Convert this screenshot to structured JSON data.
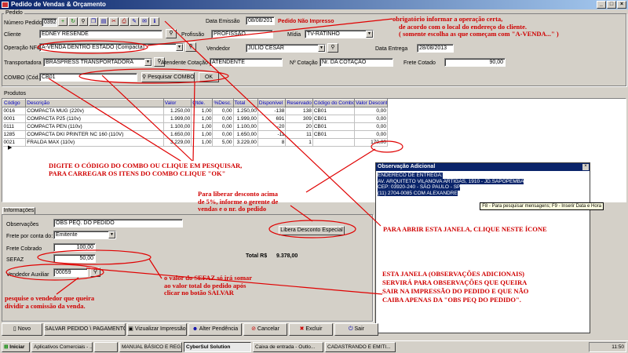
{
  "window": {
    "title": "Pedido de Vendas & Orçamento"
  },
  "header": {
    "pedido_group": "Pedido",
    "numero_label": "Número Pedido",
    "numero_value": "03924",
    "emissao_label": "Data Emissão",
    "emissao_value": "08/08/201",
    "status": "Pedido Não Impresso",
    "cliente_label": "Cliente",
    "cliente_value": "EDNEY RESENDE",
    "profissao_label": "Profissão",
    "profissao_value": "PROFISSÃO",
    "midia_label": "Mídia",
    "midia_value": "TV-RATINHO",
    "operacao_label": "Operação NFe",
    "operacao_value": "A-VENDA DENTRO ESTADO (Compacta)",
    "vendedor_label": "Vendedor",
    "vendedor_value": "JULIO CESAR",
    "entrega_label": "Data Entrega",
    "entrega_value": "28/08/2013",
    "transportadora_label": "Transportadora",
    "transportadora_value": "BRASPRESS TRANSPORTADORA",
    "atendente_label": "Atendente Cotação",
    "atendente_value": "ATENDENTE",
    "ncotacao_label": "Nº Cotação",
    "ncotacao_value": "Nr. DA COTAÇÃO",
    "frete_cotado_label": "Frete Cotado",
    "frete_cotado_value": "90,00",
    "combo_label": "COMBO (Cód.)",
    "combo_value": "CB01",
    "pesquisar_combo": "Pesquisar COMBO",
    "ok": "OK"
  },
  "produtos": {
    "group": "Produtos",
    "columns": [
      "Código",
      "Descrição",
      "Valor",
      "Qtde.",
      "%Desc.",
      "Total",
      "Disponível",
      "Reservado",
      "Código do Combo",
      "Valor Desconto"
    ],
    "rows": [
      [
        "0016",
        "COMPACTA MUG (220v)",
        "1.250,00",
        "1,00",
        "0,00",
        "1.250,00",
        "-138",
        "138",
        "CB01",
        "0,00"
      ],
      [
        "0001",
        "COMPACTA P25 (110v)",
        "1.999,00",
        "1,00",
        "0,00",
        "1.999,00",
        "691",
        "309",
        "CB01",
        "0,00"
      ],
      [
        "0111",
        "COMPACTA PEN (110v)",
        "1.100,00",
        "1,00",
        "0,00",
        "1.100,00",
        "-20",
        "20",
        "CB01",
        "0,00"
      ],
      [
        "1285",
        "COMPACTA DKI PRINTER NC 160 (110V)",
        "1.650,00",
        "1,00",
        "0,00",
        "1.650,00",
        "-11",
        "11",
        "CB01",
        "0,00"
      ],
      [
        "0021",
        "FRALDA MAX (110v)",
        "3.229,00",
        "1,00",
        "5,00",
        "3.229,00",
        "8",
        "1",
        "",
        "170,00"
      ]
    ]
  },
  "info": {
    "tab": "Informações",
    "obs_label": "Observações",
    "obs_value": "OBS PEQ. DO PEDIDO",
    "frete_conta_label": "Frete por conta do:",
    "frete_conta_value": "Emitente",
    "frete_cobrado_label": "Frete Cobrado",
    "frete_cobrado_value": "100,00",
    "sefaz_label": "SEFAZ",
    "sefaz_value": "50,00",
    "vend_aux_label": "Vendedor Auxiliar",
    "vend_aux_value": "00059",
    "libera": "Libera Desconto Especial",
    "total_label": "Total R$",
    "total_value": "9.378,00"
  },
  "popup": {
    "title": "Observação Adicional",
    "lines": [
      "ENDERECO DE ENTREGA:",
      "AV. ARQUITETO VILANOVA ARTIGAS, 1910 - JD.SAPOPEMBA",
      "CEP: 03920-240 - SÃO PAULO - SP",
      "(11) 2704-0085 COM ALEXANDRE"
    ],
    "hint": "F8 - Para pesquisar mensagens; F9 - Inserir Data e Hora"
  },
  "bottom": {
    "novo": "Novo",
    "salvar": "SALVAR PEDIDO \\ PAGAMENTOS",
    "visualizar": "Vizualizar Impressão",
    "alter": "Alter Pendência",
    "cancelar": "Cancelar",
    "excluir": "Excluir",
    "sair": "Sair"
  },
  "annotations": {
    "a1": "obrigatório informar a operação certa,",
    "a2": "de acordo com o local do endereço do cliente.",
    "a3": "( somente escolha as que começam com \"A-VENDA...\" )",
    "combo1": "DIGITE O CÓDIGO DO COMBO OU CLIQUE EM PESQUISAR,",
    "combo2": "PARA CARREGAR OS ITENS DO COMBO CLIQUE \"OK\"",
    "desc1": "Para liberar desconto acima",
    "desc2": "de 5%, informe o gerente de",
    "desc3": "vendas e o nr. do pedido",
    "abrir": "PARA ABRIR ESTA JANELA, CLIQUE NESTE ÍCONE",
    "jan1": "ESTA JANELA (OBSERVAÇÕES ADICIONAIS)",
    "jan2": "SERVIRÁ PARA OBSERVAÇÕES QUE QUEIRA",
    "jan3": "SAIR NA IMPRESSÃO DO PEDIDO E QUE NÃO",
    "jan4": "CAIBA APENAS DA \"OBS PEQ DO PEDIDO\".",
    "sefaz1": "o valor do SEFAZ só irá somar",
    "sefaz2": "ao valor total do pedido após",
    "sefaz3": "clicar no botão SALVAR",
    "vend1": "pesquise o vendedor que queira",
    "vend2": "dividir a comissão da venda."
  },
  "taskbar": {
    "start": "Iniciar",
    "items": [
      "Aplicativos Comerciais - ...",
      "",
      "MANUAL BÁSICO E REG...",
      "CyberSul Solution",
      "Caixa de entrada - Outlo...",
      "CADASTRANDO E EMITI..."
    ],
    "clock": "11:50"
  }
}
